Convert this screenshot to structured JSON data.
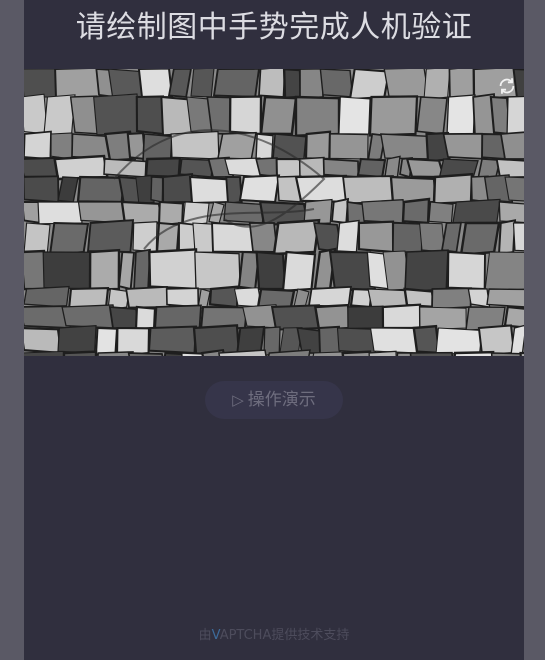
{
  "title": "请绘制图中手势完成人机验证",
  "captcha": {
    "refresh_icon": "refresh-icon"
  },
  "demo_button": {
    "play_icon": "▷",
    "label": "操作演示"
  },
  "footer": {
    "prefix": "由",
    "brand_v": "V",
    "brand_rest": "APTCHA",
    "suffix": "提供技术支持"
  },
  "colors": {
    "panel_bg": "#302f3e",
    "side_bg": "#5a5965",
    "title_text": "#dcdce2",
    "brand_v": "#3d6b9a"
  }
}
